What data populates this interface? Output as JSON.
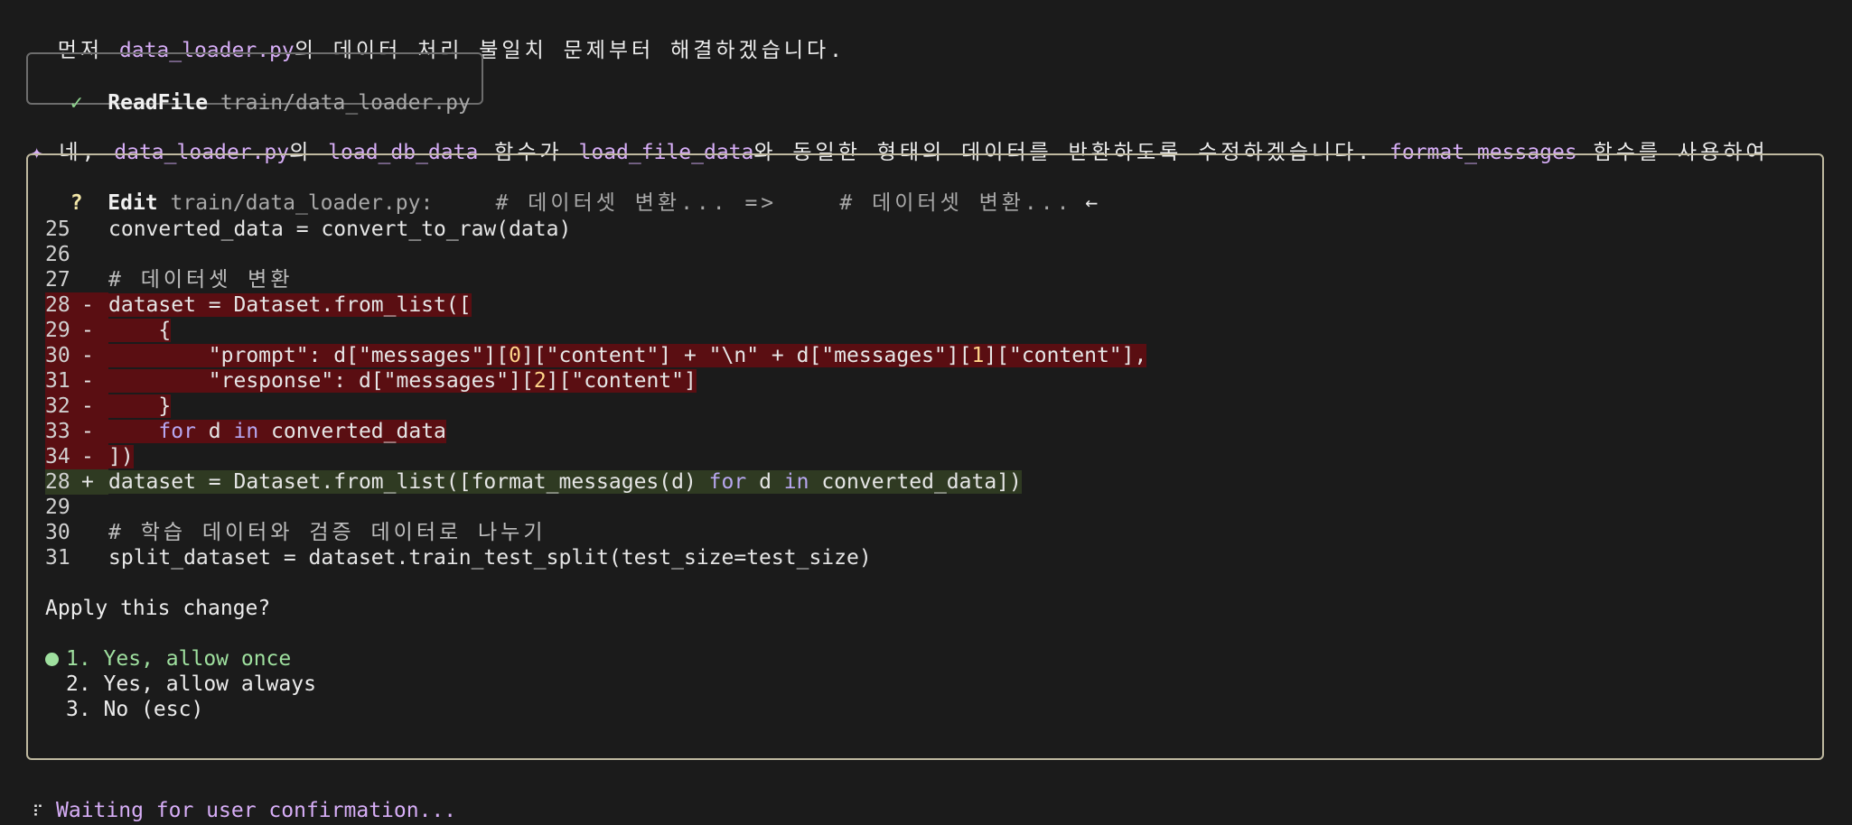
{
  "intro": {
    "prefix": "먼저 ",
    "file": "data_loader.py",
    "suffix": "의 데이터 처리 불일치 문제부터 해결하겠습니다."
  },
  "readfile": {
    "check": "✓",
    "tool": "ReadFile",
    "path": "train/data_loader.py"
  },
  "message": {
    "star": "✦",
    "p1": " 네, ",
    "file": "data_loader.py",
    "p2": "의 ",
    "fn1": "load_db_data",
    "p3": " 함수가 ",
    "fn2": "load_file_data",
    "p4": "와 동일한 형태의 데이터를 반환하도록 수정하겠습니다. ",
    "fn3": "format_messages",
    "p5": " 함수를 사용하여"
  },
  "edit": {
    "q": "?",
    "tool": "Edit",
    "path": "train/data_loader.py:",
    "from": "# 데이터셋 변환... =>",
    "to": "# 데이터셋 변환...",
    "arrow": "←"
  },
  "diff": {
    "l25": {
      "n": "25",
      "t": "converted_data = convert_to_raw(data)"
    },
    "l26": {
      "n": "26"
    },
    "l27": {
      "n": "27",
      "t": "# 데이터셋 변환"
    },
    "d28": {
      "n": "28",
      "t": "dataset = Dataset.from_list(["
    },
    "d29": {
      "n": "29",
      "t": "    {"
    },
    "d30": {
      "n": "30",
      "a": "        \"prompt\": d[\"messages\"][",
      "b": "0",
      "c": "][\"content\"] + \"\\n\" + d[\"messages\"][",
      "d": "1",
      "e": "][\"content\"],"
    },
    "d31": {
      "n": "31",
      "a": "        \"response\": d[\"messages\"][",
      "b": "2",
      "c": "][\"content\"]"
    },
    "d32": {
      "n": "32",
      "t": "    }"
    },
    "d33": {
      "n": "33",
      "a": "    ",
      "kw1": "for",
      "b": " d ",
      "kw2": "in",
      "c": " converted_data"
    },
    "d34": {
      "n": "34",
      "t": "])"
    },
    "a28": {
      "n": "28",
      "a": "dataset = Dataset.from_list([format_messages(d) ",
      "kw1": "for",
      "b": " d ",
      "kw2": "in",
      "c": " converted_data])"
    },
    "l29": {
      "n": "29"
    },
    "l30": {
      "n": "30",
      "t": "# 학습 데이터와 검증 데이터로 나누기"
    },
    "l31": {
      "n": "31",
      "t": "split_dataset = dataset.train_test_split(test_size=test_size)"
    },
    "minus": "-",
    "plus": "+"
  },
  "prompt": "Apply this change?",
  "options": [
    "1. Yes, allow once",
    "2. Yes, allow always",
    "3. No (esc)"
  ],
  "status": {
    "spinner": "⠏",
    "text": "Waiting for user confirmation..."
  }
}
